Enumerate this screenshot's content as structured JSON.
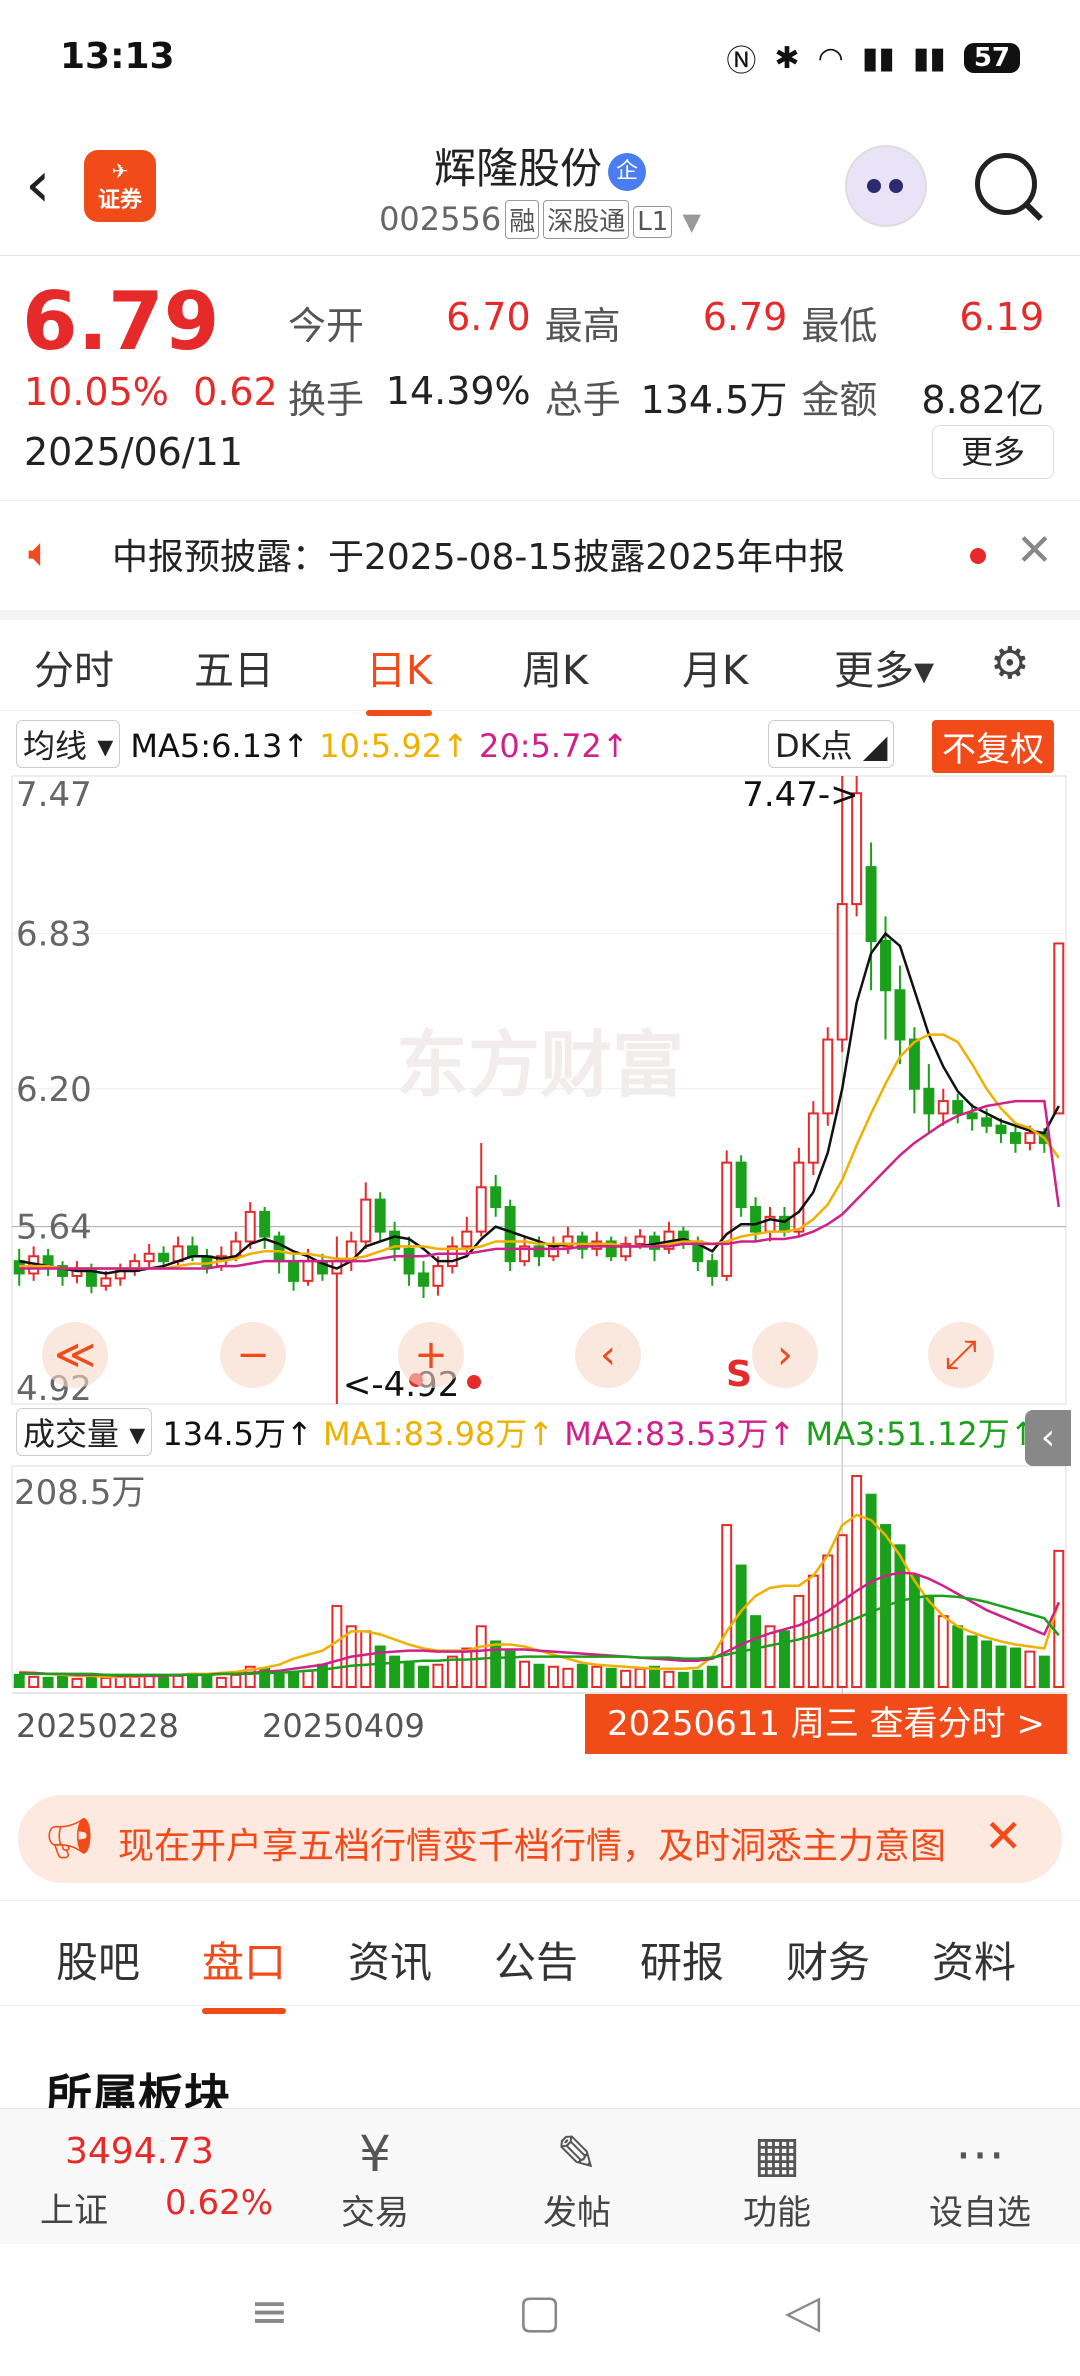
{
  "status": {
    "time": "13:13",
    "battery": "57"
  },
  "header": {
    "logo_top": "✈",
    "logo_text": "证券",
    "title": "辉隆股份",
    "title_badge": "企",
    "code": "002556",
    "tags": [
      "融",
      "深股通",
      "L1"
    ]
  },
  "quote": {
    "price": "6.79",
    "change_pct": "10.05%",
    "change_abs": "0.62",
    "date": "2025/06/11",
    "fields": [
      {
        "label": "今开",
        "value": "6.70",
        "color": "#e62a2a"
      },
      {
        "label": "最高",
        "value": "6.79",
        "color": "#e62a2a"
      },
      {
        "label": "最低",
        "value": "6.19",
        "color": "#e62a2a"
      },
      {
        "label": "换手",
        "value": "14.39%",
        "color": "#222222"
      },
      {
        "label": "总手",
        "value": "134.5万",
        "color": "#222222"
      },
      {
        "label": "金额",
        "value": "8.82亿",
        "color": "#222222"
      }
    ],
    "more": "更多"
  },
  "notice": {
    "text": "中报预披露：于2025-08-15披露2025年中报"
  },
  "tabs": [
    "分时",
    "五日",
    "日K",
    "周K",
    "月K",
    "更多▾"
  ],
  "active_tab": "日K",
  "chart": {
    "ma_select": "均线",
    "ma5": "MA5:6.13↑",
    "ma10": "10:5.92↑",
    "ma20": "20:5.72↑",
    "dk": "DK点",
    "fq": "不复权",
    "y_labels": [
      "7.47",
      "6.83",
      "6.20",
      "5.64",
      "4.92"
    ],
    "high_mark": "7.47->",
    "low_mark": "<-4.92",
    "s_mark": "S",
    "watermark": "东方财富",
    "controls": [
      "≪",
      "−",
      "+",
      "‹",
      "›",
      "⤢"
    ],
    "vol_select": "成交量",
    "vol_value": "134.5万↑",
    "vma1": "MA1:83.98万↑",
    "vma2": "MA2:83.53万↑",
    "vma3": "MA3:51.12万↑",
    "vol_max": "208.5万",
    "x_labels": [
      "20250228",
      "20250409"
    ],
    "date_button": "20250611 周三 查看分时 >",
    "colors": {
      "up": "#e62a2a",
      "down": "#1aa01a",
      "ma5": "#111111",
      "ma10": "#f0b000",
      "ma20": "#d0208a",
      "vma3": "#1aa01a"
    }
  },
  "chart_data": {
    "type": "candlestick",
    "ylim": [
      4.92,
      7.47
    ],
    "reference_price": 5.64,
    "high": 7.47,
    "low": 4.92,
    "candles": [
      {
        "o": 5.5,
        "c": 5.45,
        "h": 5.55,
        "l": 5.4
      },
      {
        "o": 5.45,
        "c": 5.52,
        "h": 5.56,
        "l": 5.42
      },
      {
        "o": 5.52,
        "c": 5.48,
        "h": 5.55,
        "l": 5.44
      },
      {
        "o": 5.48,
        "c": 5.44,
        "h": 5.5,
        "l": 5.4
      },
      {
        "o": 5.44,
        "c": 5.47,
        "h": 5.5,
        "l": 5.41
      },
      {
        "o": 5.47,
        "c": 5.4,
        "h": 5.49,
        "l": 5.37
      },
      {
        "o": 5.4,
        "c": 5.43,
        "h": 5.46,
        "l": 5.38
      },
      {
        "o": 5.43,
        "c": 5.46,
        "h": 5.49,
        "l": 5.4
      },
      {
        "o": 5.46,
        "c": 5.5,
        "h": 5.53,
        "l": 5.44
      },
      {
        "o": 5.5,
        "c": 5.53,
        "h": 5.57,
        "l": 5.47
      },
      {
        "o": 5.53,
        "c": 5.5,
        "h": 5.56,
        "l": 5.47
      },
      {
        "o": 5.5,
        "c": 5.56,
        "h": 5.6,
        "l": 5.48
      },
      {
        "o": 5.56,
        "c": 5.52,
        "h": 5.6,
        "l": 5.5
      },
      {
        "o": 5.52,
        "c": 5.48,
        "h": 5.55,
        "l": 5.45
      },
      {
        "o": 5.48,
        "c": 5.52,
        "h": 5.56,
        "l": 5.46
      },
      {
        "o": 5.52,
        "c": 5.58,
        "h": 5.62,
        "l": 5.5
      },
      {
        "o": 5.58,
        "c": 5.7,
        "h": 5.74,
        "l": 5.55
      },
      {
        "o": 5.7,
        "c": 5.6,
        "h": 5.72,
        "l": 5.55
      },
      {
        "o": 5.6,
        "c": 5.5,
        "h": 5.62,
        "l": 5.45
      },
      {
        "o": 5.5,
        "c": 5.42,
        "h": 5.53,
        "l": 5.38
      },
      {
        "o": 5.42,
        "c": 5.5,
        "h": 5.55,
        "l": 5.4
      },
      {
        "o": 5.5,
        "c": 5.45,
        "h": 5.53,
        "l": 5.42
      },
      {
        "o": 5.45,
        "c": 5.5,
        "h": 5.6,
        "l": 4.92
      },
      {
        "o": 5.5,
        "c": 5.58,
        "h": 5.62,
        "l": 5.46
      },
      {
        "o": 5.58,
        "c": 5.75,
        "h": 5.82,
        "l": 5.55
      },
      {
        "o": 5.75,
        "c": 5.62,
        "h": 5.78,
        "l": 5.58
      },
      {
        "o": 5.62,
        "c": 5.55,
        "h": 5.66,
        "l": 5.5
      },
      {
        "o": 5.55,
        "c": 5.45,
        "h": 5.6,
        "l": 5.4
      },
      {
        "o": 5.45,
        "c": 5.4,
        "h": 5.5,
        "l": 5.35
      },
      {
        "o": 5.4,
        "c": 5.48,
        "h": 5.52,
        "l": 5.36
      },
      {
        "o": 5.48,
        "c": 5.56,
        "h": 5.6,
        "l": 5.45
      },
      {
        "o": 5.56,
        "c": 5.62,
        "h": 5.68,
        "l": 5.53
      },
      {
        "o": 5.62,
        "c": 5.8,
        "h": 5.98,
        "l": 5.6
      },
      {
        "o": 5.8,
        "c": 5.72,
        "h": 5.85,
        "l": 5.68
      },
      {
        "o": 5.72,
        "c": 5.5,
        "h": 5.75,
        "l": 5.46
      },
      {
        "o": 5.5,
        "c": 5.56,
        "h": 5.6,
        "l": 5.48
      },
      {
        "o": 5.56,
        "c": 5.52,
        "h": 5.6,
        "l": 5.48
      },
      {
        "o": 5.52,
        "c": 5.56,
        "h": 5.6,
        "l": 5.5
      },
      {
        "o": 5.56,
        "c": 5.6,
        "h": 5.64,
        "l": 5.53
      },
      {
        "o": 5.6,
        "c": 5.55,
        "h": 5.62,
        "l": 5.51
      },
      {
        "o": 5.55,
        "c": 5.58,
        "h": 5.62,
        "l": 5.52
      },
      {
        "o": 5.58,
        "c": 5.52,
        "h": 5.6,
        "l": 5.5
      },
      {
        "o": 5.52,
        "c": 5.57,
        "h": 5.6,
        "l": 5.5
      },
      {
        "o": 5.57,
        "c": 5.6,
        "h": 5.63,
        "l": 5.55
      },
      {
        "o": 5.6,
        "c": 5.55,
        "h": 5.62,
        "l": 5.5
      },
      {
        "o": 5.55,
        "c": 5.62,
        "h": 5.66,
        "l": 5.53
      },
      {
        "o": 5.62,
        "c": 5.58,
        "h": 5.64,
        "l": 5.55
      },
      {
        "o": 5.58,
        "c": 5.5,
        "h": 5.6,
        "l": 5.46
      },
      {
        "o": 5.5,
        "c": 5.44,
        "h": 5.53,
        "l": 5.4
      },
      {
        "o": 5.44,
        "c": 5.9,
        "h": 5.95,
        "l": 5.42
      },
      {
        "o": 5.9,
        "c": 5.72,
        "h": 5.93,
        "l": 5.68
      },
      {
        "o": 5.72,
        "c": 5.62,
        "h": 5.76,
        "l": 5.58
      },
      {
        "o": 5.62,
        "c": 5.68,
        "h": 5.72,
        "l": 5.58
      },
      {
        "o": 5.68,
        "c": 5.62,
        "h": 5.72,
        "l": 5.6
      },
      {
        "o": 5.62,
        "c": 5.9,
        "h": 5.96,
        "l": 5.6
      },
      {
        "o": 5.9,
        "c": 6.1,
        "h": 6.15,
        "l": 5.85
      },
      {
        "o": 6.1,
        "c": 6.4,
        "h": 6.45,
        "l": 6.05
      },
      {
        "o": 6.4,
        "c": 6.95,
        "h": 7.47,
        "l": 6.35
      },
      {
        "o": 6.95,
        "c": 7.4,
        "h": 7.47,
        "l": 6.9
      },
      {
        "o": 7.1,
        "c": 6.8,
        "h": 7.2,
        "l": 6.6
      },
      {
        "o": 6.8,
        "c": 6.6,
        "h": 6.9,
        "l": 6.4
      },
      {
        "o": 6.6,
        "c": 6.4,
        "h": 6.7,
        "l": 6.3
      },
      {
        "o": 6.4,
        "c": 6.2,
        "h": 6.45,
        "l": 6.1
      },
      {
        "o": 6.2,
        "c": 6.1,
        "h": 6.3,
        "l": 6.02
      },
      {
        "o": 6.1,
        "c": 6.15,
        "h": 6.2,
        "l": 6.05
      },
      {
        "o": 6.15,
        "c": 6.1,
        "h": 6.18,
        "l": 6.06
      },
      {
        "o": 6.1,
        "c": 6.08,
        "h": 6.14,
        "l": 6.03
      },
      {
        "o": 6.08,
        "c": 6.05,
        "h": 6.12,
        "l": 6.02
      },
      {
        "o": 6.05,
        "c": 6.02,
        "h": 6.08,
        "l": 5.98
      },
      {
        "o": 6.02,
        "c": 5.98,
        "h": 6.05,
        "l": 5.94
      },
      {
        "o": 5.98,
        "c": 6.02,
        "h": 6.05,
        "l": 5.95
      },
      {
        "o": 6.02,
        "c": 5.98,
        "h": 6.04,
        "l": 5.94
      },
      {
        "o": 6.1,
        "c": 6.79,
        "h": 6.79,
        "l": 6.19
      }
    ],
    "series": [
      {
        "name": "MA5",
        "values": [
          5.5,
          5.49,
          5.48,
          5.47,
          5.46,
          5.46,
          5.45,
          5.46,
          5.46,
          5.47,
          5.48,
          5.5,
          5.52,
          5.52,
          5.51,
          5.52,
          5.57,
          5.59,
          5.57,
          5.54,
          5.52,
          5.49,
          5.47,
          5.5,
          5.56,
          5.58,
          5.6,
          5.59,
          5.55,
          5.5,
          5.5,
          5.52,
          5.59,
          5.64,
          5.62,
          5.6,
          5.58,
          5.56,
          5.57,
          5.57,
          5.57,
          5.56,
          5.56,
          5.56,
          5.57,
          5.58,
          5.59,
          5.57,
          5.54,
          5.61,
          5.65,
          5.65,
          5.67,
          5.66,
          5.7,
          5.78,
          5.94,
          6.2,
          6.55,
          6.75,
          6.83,
          6.78,
          6.6,
          6.42,
          6.29,
          6.19,
          6.13,
          6.1,
          6.07,
          6.05,
          6.03,
          6.02,
          6.13
        ]
      },
      {
        "name": "MA10",
        "values": [
          5.48,
          5.48,
          5.48,
          5.47,
          5.47,
          5.47,
          5.47,
          5.47,
          5.47,
          5.47,
          5.47,
          5.48,
          5.49,
          5.49,
          5.5,
          5.51,
          5.53,
          5.54,
          5.54,
          5.53,
          5.53,
          5.52,
          5.51,
          5.51,
          5.52,
          5.54,
          5.56,
          5.56,
          5.56,
          5.55,
          5.55,
          5.55,
          5.56,
          5.58,
          5.58,
          5.58,
          5.57,
          5.57,
          5.57,
          5.57,
          5.57,
          5.57,
          5.56,
          5.56,
          5.56,
          5.57,
          5.58,
          5.58,
          5.57,
          5.58,
          5.6,
          5.61,
          5.62,
          5.62,
          5.63,
          5.67,
          5.73,
          5.83,
          5.97,
          6.1,
          6.22,
          6.33,
          6.39,
          6.42,
          6.42,
          6.39,
          6.3,
          6.2,
          6.12,
          6.06,
          6.04,
          6.0,
          5.92
        ]
      },
      {
        "name": "MA20",
        "values": [
          5.47,
          5.47,
          5.47,
          5.47,
          5.47,
          5.47,
          5.47,
          5.47,
          5.47,
          5.47,
          5.47,
          5.47,
          5.47,
          5.47,
          5.48,
          5.48,
          5.49,
          5.5,
          5.5,
          5.5,
          5.5,
          5.5,
          5.5,
          5.5,
          5.5,
          5.51,
          5.52,
          5.52,
          5.52,
          5.53,
          5.53,
          5.53,
          5.54,
          5.55,
          5.55,
          5.55,
          5.55,
          5.55,
          5.55,
          5.56,
          5.56,
          5.56,
          5.56,
          5.56,
          5.56,
          5.56,
          5.57,
          5.57,
          5.57,
          5.57,
          5.58,
          5.58,
          5.59,
          5.59,
          5.6,
          5.62,
          5.65,
          5.69,
          5.75,
          5.81,
          5.87,
          5.93,
          5.98,
          6.02,
          6.06,
          6.09,
          6.11,
          6.13,
          6.14,
          6.15,
          6.15,
          6.15,
          5.72
        ]
      }
    ],
    "volume": {
      "ylim": [
        0,
        208.5
      ],
      "unit": "万",
      "values": [
        12,
        10,
        9,
        11,
        8,
        10,
        9,
        11,
        10,
        12,
        9,
        11,
        13,
        10,
        9,
        12,
        20,
        18,
        15,
        14,
        16,
        22,
        80,
        60,
        55,
        40,
        30,
        25,
        20,
        22,
        30,
        38,
        60,
        45,
        35,
        25,
        22,
        20,
        18,
        22,
        20,
        18,
        16,
        18,
        20,
        15,
        14,
        16,
        20,
        160,
        120,
        70,
        60,
        55,
        90,
        110,
        130,
        150,
        208.5,
        190,
        160,
        140,
        110,
        90,
        70,
        60,
        50,
        45,
        40,
        38,
        35,
        30,
        134.5
      ],
      "ma1": [
        15,
        14,
        13,
        12,
        11,
        11,
        10,
        10,
        10,
        11,
        11,
        12,
        13,
        13,
        14,
        15,
        17,
        19,
        22,
        28,
        32,
        36,
        45,
        55,
        55,
        52,
        47,
        42,
        38,
        36,
        36,
        36,
        40,
        42,
        42,
        40,
        36,
        32,
        28,
        24,
        22,
        21,
        20,
        19,
        18,
        18,
        18,
        19,
        30,
        55,
        75,
        90,
        98,
        100,
        100,
        110,
        130,
        160,
        170,
        165,
        150,
        130,
        105,
        85,
        70,
        60,
        54,
        49,
        45,
        42,
        40,
        38,
        84
      ],
      "ma2": [
        14,
        14,
        13,
        13,
        12,
        12,
        12,
        11,
        11,
        11,
        11,
        12,
        12,
        12,
        13,
        13,
        14,
        15,
        16,
        18,
        20,
        22,
        26,
        30,
        32,
        34,
        35,
        36,
        36,
        35,
        35,
        35,
        36,
        37,
        37,
        37,
        36,
        35,
        34,
        33,
        32,
        31,
        30,
        29,
        28,
        27,
        26,
        26,
        28,
        35,
        42,
        48,
        53,
        57,
        61,
        67,
        75,
        85,
        95,
        104,
        110,
        113,
        112,
        107,
        100,
        92,
        84,
        76,
        70,
        64,
        58,
        52,
        83.5
      ],
      "ma3": [
        13,
        13,
        13,
        13,
        13,
        13,
        12,
        12,
        12,
        12,
        12,
        12,
        12,
        12,
        13,
        13,
        13,
        14,
        14,
        15,
        16,
        17,
        19,
        21,
        22,
        23,
        24,
        25,
        26,
        26,
        27,
        27,
        28,
        29,
        29,
        30,
        30,
        30,
        30,
        30,
        30,
        30,
        30,
        29,
        29,
        29,
        28,
        28,
        29,
        32,
        35,
        38,
        41,
        44,
        47,
        51,
        56,
        62,
        68,
        74,
        80,
        85,
        88,
        90,
        90,
        89,
        87,
        84,
        80,
        76,
        72,
        68,
        51.1
      ]
    }
  },
  "promo": {
    "text": "现在开户享五档行情变千档行情，及时洞悉主力意图"
  },
  "tabs2": [
    "股吧",
    "盘口",
    "资讯",
    "公告",
    "研报",
    "财务",
    "资料"
  ],
  "active_tab2": "盘口",
  "section_title": "所属板块",
  "bottom": {
    "index_value": "3494.73",
    "index_name": "上证",
    "index_pct": "0.62%",
    "items": [
      {
        "icon": "¥",
        "label": "交易"
      },
      {
        "icon": "✎",
        "label": "发帖"
      },
      {
        "icon": "▦",
        "label": "功能"
      },
      {
        "icon": "⋯",
        "label": "设自选"
      }
    ]
  }
}
